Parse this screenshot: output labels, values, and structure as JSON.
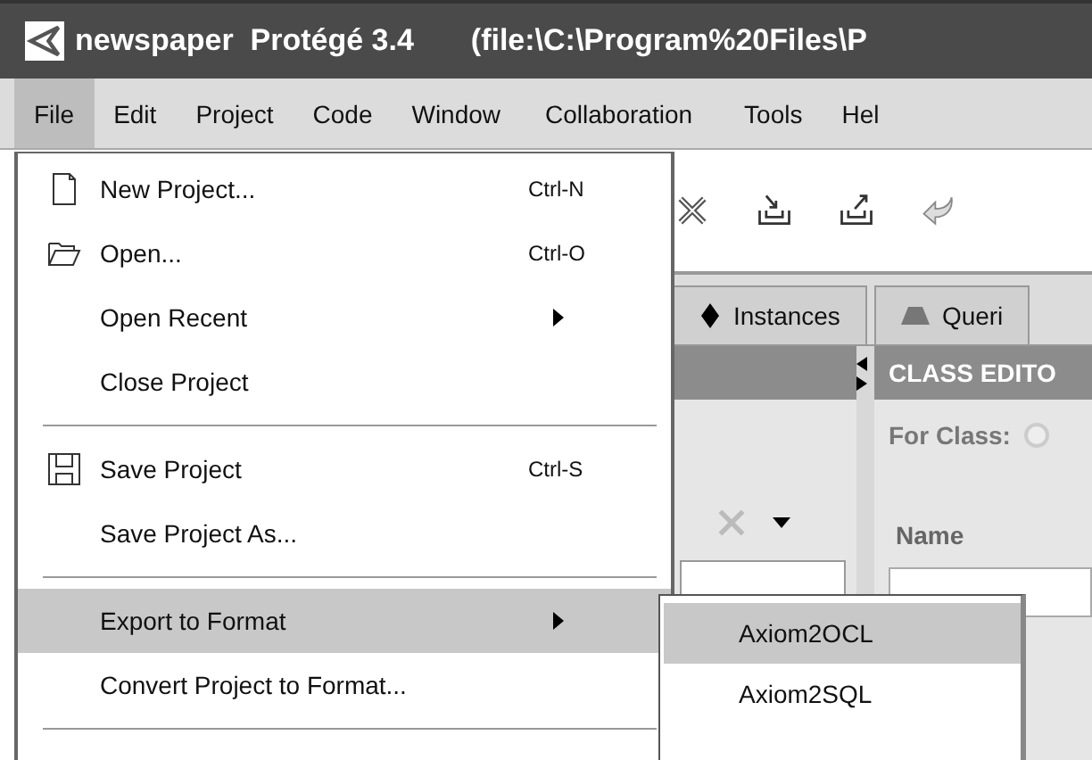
{
  "window": {
    "title": "newspaper  Protégé 3.4",
    "path": "(file:\\C:\\Program%20Files\\P"
  },
  "menubar": [
    {
      "label": "File",
      "selected": true
    },
    {
      "label": "Edit",
      "selected": false
    },
    {
      "label": "Project",
      "selected": false
    },
    {
      "label": "Code",
      "selected": false
    },
    {
      "label": "Window",
      "selected": false
    },
    {
      "label": "Collaboration",
      "selected": false
    },
    {
      "label": "Tools",
      "selected": false
    },
    {
      "label": "Hel",
      "selected": false
    }
  ],
  "file_menu": [
    {
      "kind": "item",
      "label": "New Project...",
      "shortcut": "Ctrl-N",
      "selected": false
    },
    {
      "kind": "item",
      "label": "Open...",
      "shortcut": "Ctrl-O",
      "selected": false
    },
    {
      "kind": "submenu",
      "label": "Open Recent",
      "selected": false
    },
    {
      "kind": "item",
      "label": "Close Project",
      "selected": false
    },
    {
      "kind": "separator"
    },
    {
      "kind": "item",
      "label": "Save Project",
      "shortcut": "Ctrl-S",
      "selected": false
    },
    {
      "kind": "item",
      "label": "Save Project As...",
      "selected": false
    },
    {
      "kind": "separator"
    },
    {
      "kind": "submenu",
      "label": "Export to Format",
      "selected": true
    },
    {
      "kind": "item",
      "label": "Convert Project to Format...",
      "selected": false
    },
    {
      "kind": "separator"
    }
  ],
  "export_submenu": [
    {
      "label": "Axiom2OCL",
      "selected": true
    },
    {
      "label": "Axiom2SQL",
      "selected": false
    }
  ],
  "tabs": [
    {
      "label": "Instances",
      "selected": false
    },
    {
      "label": "Queri",
      "selected": false
    }
  ],
  "class_editor": {
    "title": "CLASS EDITO",
    "for_class_label": "For Class:",
    "name_label": "Name"
  }
}
